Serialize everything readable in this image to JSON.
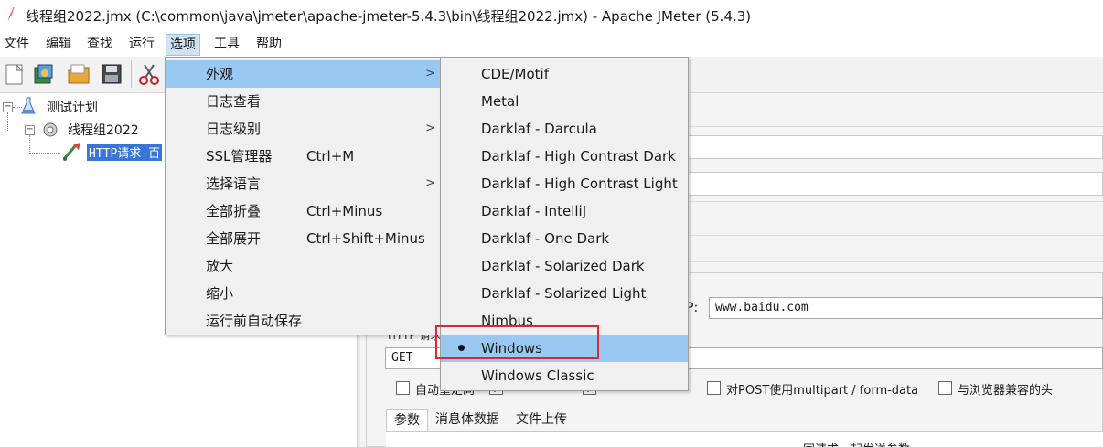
{
  "window": {
    "title": "线程组2022.jmx (C:\\common\\java\\jmeter\\apache-jmeter-5.4.3\\bin\\线程组2022.jmx) - Apache JMeter (5.4.3)"
  },
  "menubar": {
    "items": [
      {
        "label": "文件"
      },
      {
        "label": "编辑"
      },
      {
        "label": "查找"
      },
      {
        "label": "运行"
      },
      {
        "label": "选项",
        "active": true
      },
      {
        "label": "工具"
      },
      {
        "label": "帮助"
      }
    ]
  },
  "toolbar": {
    "icons": [
      "new-icon",
      "templates-icon",
      "open-icon",
      "save-icon",
      "cut-icon"
    ]
  },
  "tree": {
    "nodes": [
      {
        "label": "测试计划",
        "icon": "test-plan-icon"
      },
      {
        "label": "线程组2022",
        "icon": "thread-group-icon"
      },
      {
        "label": "HTTP请求-百",
        "icon": "http-sampler-icon",
        "selected": true
      }
    ]
  },
  "options_menu": {
    "items": [
      {
        "label": "外观",
        "shortcut": "",
        "submenu": true,
        "highlighted": true
      },
      {
        "label": "日志查看",
        "shortcut": "",
        "submenu": false
      },
      {
        "label": "日志级别",
        "shortcut": "",
        "submenu": true
      },
      {
        "label": "SSL管理器",
        "shortcut": "Ctrl+M",
        "submenu": false
      },
      {
        "label": "选择语言",
        "shortcut": "",
        "submenu": true
      },
      {
        "label": "全部折叠",
        "shortcut": "Ctrl+Minus",
        "submenu": false
      },
      {
        "label": "全部展开",
        "shortcut": "Ctrl+Shift+Minus",
        "submenu": false
      },
      {
        "label": "放大",
        "shortcut": "",
        "submenu": false
      },
      {
        "label": "缩小",
        "shortcut": "",
        "submenu": false
      },
      {
        "label": "运行前自动保存",
        "shortcut": "",
        "submenu": false
      }
    ],
    "submenu_arrow": ">"
  },
  "laf_submenu": {
    "items": [
      {
        "label": "CDE/Motif",
        "selected": false
      },
      {
        "label": "Metal",
        "selected": false
      },
      {
        "label": "Darklaf - Darcula",
        "selected": false
      },
      {
        "label": "Darklaf - High Contrast Dark",
        "selected": false
      },
      {
        "label": "Darklaf - High Contrast Light",
        "selected": false
      },
      {
        "label": "Darklaf - IntelliJ",
        "selected": false
      },
      {
        "label": "Darklaf - One Dark",
        "selected": false
      },
      {
        "label": "Darklaf - Solarized Dark",
        "selected": false
      },
      {
        "label": "Darklaf - Solarized Light",
        "selected": false
      },
      {
        "label": "Nimbus",
        "selected": false
      },
      {
        "label": "Windows",
        "selected": true
      },
      {
        "label": "Windows Classic",
        "selected": false
      }
    ]
  },
  "editor": {
    "server_label_fragment": "P:",
    "server_value": "www.baidu.com",
    "method_label_fragment": "HTTP 请求",
    "method_value": "GET",
    "checkboxes": [
      {
        "label": "自动重定向",
        "checked": false
      },
      {
        "label": "",
        "checked": true
      },
      {
        "label": "",
        "checked": true
      },
      {
        "label": "对POST使用multipart / form-data",
        "checked": false
      },
      {
        "label": "与浏览器兼容的头",
        "checked": false
      }
    ],
    "tabs": [
      {
        "label": "参数",
        "selected": true
      },
      {
        "label": "消息体数据",
        "selected": false
      },
      {
        "label": "文件上传",
        "selected": false
      }
    ],
    "params_header_fragment": "同请求一起发送参数"
  },
  "colors": {
    "menu_highlight": "#99c9f3",
    "menu_background": "#f0f0f0",
    "annotation_box": "#d62b2b",
    "tree_selection": "#3875d7"
  }
}
